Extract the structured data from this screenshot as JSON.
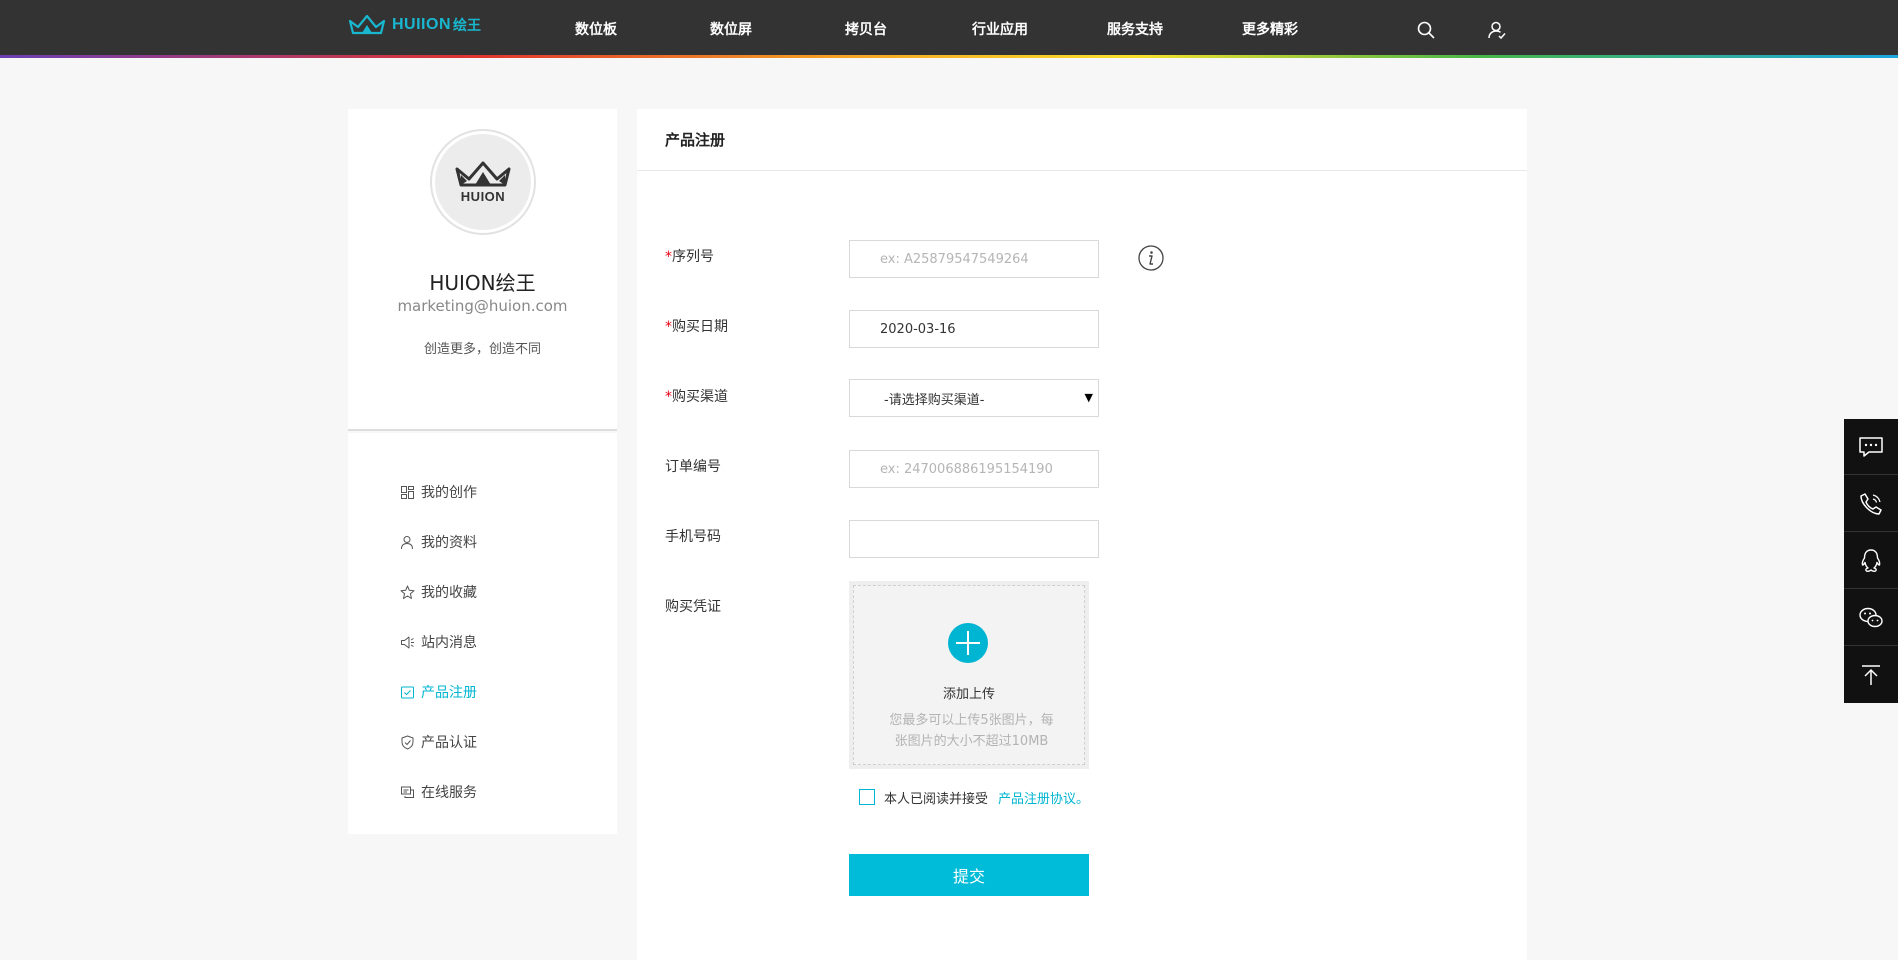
{
  "header": {
    "logo_text": "HUIION",
    "logo_cn": "绘王",
    "nav": [
      "数位板",
      "数位屏",
      "拷贝台",
      "行业应用",
      "服务支持",
      "更多精彩"
    ],
    "icons": [
      "search-icon",
      "user-icon"
    ]
  },
  "profile": {
    "avatar_text": "HUION",
    "name": "HUION绘王",
    "email": "marketing@huion.com",
    "slogan": "创造更多，创造不同"
  },
  "menu": {
    "items": [
      {
        "label": "我的创作",
        "icon": "grid-icon"
      },
      {
        "label": "我的资料",
        "icon": "user-icon"
      },
      {
        "label": "我的收藏",
        "icon": "star-icon"
      },
      {
        "label": "站内消息",
        "icon": "megaphone-icon"
      },
      {
        "label": "产品注册",
        "icon": "check-box-icon",
        "active": true
      },
      {
        "label": "产品认证",
        "icon": "shield-check-icon"
      },
      {
        "label": "在线服务",
        "icon": "chat-icon"
      }
    ],
    "active_color": "#00b5d1"
  },
  "form": {
    "title": "产品注册",
    "required_mark": "*",
    "serial": {
      "label": "序列号",
      "placeholder": "ex: A25879547549264",
      "value": ""
    },
    "purchase_date": {
      "label": "购买日期",
      "value": "2020-03-16"
    },
    "channel": {
      "label": "购买渠道",
      "selected": "-请选择购买渠道-"
    },
    "order_no": {
      "label": "订单编号",
      "placeholder": "ex: 247006886195154190",
      "value": ""
    },
    "phone": {
      "label": "手机号码",
      "placeholder": "",
      "value": ""
    },
    "proof": {
      "label": "购买凭证",
      "upload_title": "添加上传",
      "upload_hint": "您最多可以上传5张图片，每张图片的大小不超过10MB"
    },
    "agree_text": "本人已阅读并接受",
    "agree_link": "产品注册协议。",
    "submit_label": "提交"
  },
  "float_bar": {
    "icons": [
      "message-icon",
      "phone-icon",
      "qq-icon",
      "wechat-icon",
      "back-to-top-icon"
    ]
  },
  "colors": {
    "accent": "#00b5d1",
    "header_bg": "#333333",
    "required": "#e60012"
  }
}
